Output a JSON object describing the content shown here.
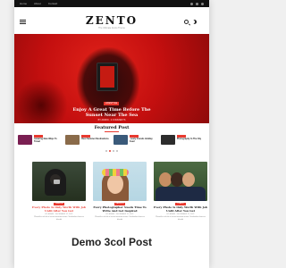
{
  "topbar": {
    "items": [
      "Home",
      "About",
      "Contact"
    ]
  },
  "header": {
    "logo": "ZENTO",
    "tagline": "The Ultimate Zento Theme"
  },
  "hero": {
    "category": "LIFESTYLE",
    "title_line1": "Enjoy A Great Time Before The",
    "title_line2": "Sunset Near The Sea",
    "meta": "BY ADMIN · 2 COMMENTS"
  },
  "featured": {
    "title": "Featured Post",
    "items": [
      {
        "title": "Amazing New Ways To Travel",
        "color": "#7a1f52"
      },
      {
        "title": "Best Summer Destinations",
        "color": "#8a6b4a"
      },
      {
        "title": "Lovely Friends Holiday Road",
        "color": "#3a5a7a"
      },
      {
        "title": "Photography In The City",
        "color": "#2c2c2c"
      }
    ],
    "active_dot": 1,
    "dot_count": 4
  },
  "posts": [
    {
      "category": "CAMERA",
      "title": "Every Photo Is Only Worth With Job Until After You Get",
      "meta": "BY ADMIN · DECEMBER 12, 2021",
      "excerpt": "Phasellus vel elit ut lectus tincidunt ornare. Vestibulum rhoncus blandit",
      "accent": true
    },
    {
      "category": "FASHION",
      "title": "Every Photographer Needs Time To Write And Get Inspired",
      "meta": "BY ADMIN · DECEMBER 12, 2021",
      "excerpt": "Phasellus vel elit ut lectus tincidunt ornare. Vestibulum rhoncus blandit",
      "accent": false
    },
    {
      "category": "TRAVEL",
      "title": "Every Photo Is Only Worth With Job Until After You Get",
      "meta": "BY ADMIN · DECEMBER 12, 2021",
      "excerpt": "Phasellus vel elit ut lectus tincidunt ornare. Vestibulum rhoncus blandit",
      "accent": false
    }
  ],
  "caption": "Demo 3col Post",
  "colors": {
    "accent": "#e8392f",
    "hero_red": "#c40f0f"
  }
}
